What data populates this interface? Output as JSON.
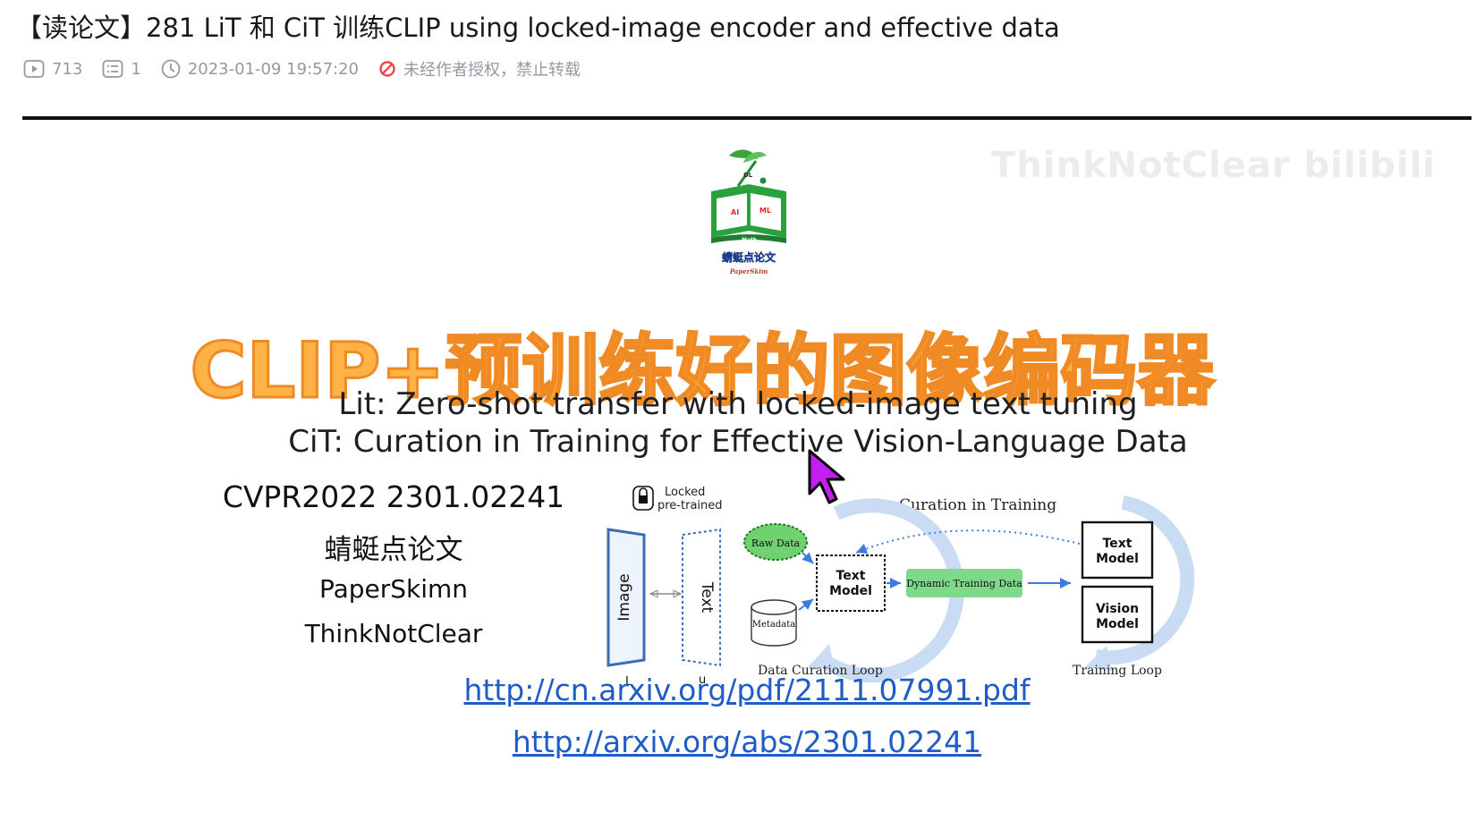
{
  "video": {
    "title": "【读论文】281 LiT 和 CiT 训练CLIP using locked-image encoder and effective data",
    "views": "713",
    "comments": "1",
    "datetime": "2023-01-09 19:57:20",
    "copyright_notice": "未经作者授权，禁止转载"
  },
  "slide": {
    "watermark": "ThinkNotClear bilibili",
    "logo_text": "蜻蜓点论文",
    "logo_subtext": "PaperSkim",
    "logo_labels": {
      "ai": "AI",
      "ml": "ML",
      "dl": "DL",
      "math": "Math"
    },
    "main_title": "CLIP+预训练好的图像编码器",
    "subtitle_lit": "Lit: Zero-shot transfer with locked-image text tuning",
    "subtitle_cit": "CiT: Curation in Training for Effective Vision-Language Data",
    "venue": "CVPR2022  2301.02241",
    "channel_cn": "蜻蜓点论文",
    "channel_en": "PaperSkimn",
    "author": "ThinkNotClear",
    "link1": "http://cn.arxiv.org/pdf/2111.07991.pdf",
    "link2": "http://arxiv.org/abs/2301.02241",
    "figure_lit": {
      "locked_label_1": "Locked",
      "locked_label_2": "pre-trained",
      "image_label": "Image",
      "text_label": "Text",
      "l_mark": "L",
      "u_mark": "u"
    },
    "figure_cit": {
      "curation_title": "Curation in Training",
      "raw_data": "Raw Data",
      "metadata": "Metadata",
      "text_model_1": "Text",
      "text_model_2": "Model",
      "dynamic_data": "Dynamic Training Data",
      "vision_model_1": "Vision",
      "vision_model_2": "Model",
      "data_loop": "Data Curation Loop",
      "training_loop": "Training Loop"
    },
    "colors": {
      "title_fill": "#ffb347",
      "title_stroke": "#f08a24",
      "link": "#1f5cc8",
      "loop_blue": "#c9dcf3",
      "green_box": "#7fd98a",
      "raw_data_green": "#6fd16f"
    }
  }
}
